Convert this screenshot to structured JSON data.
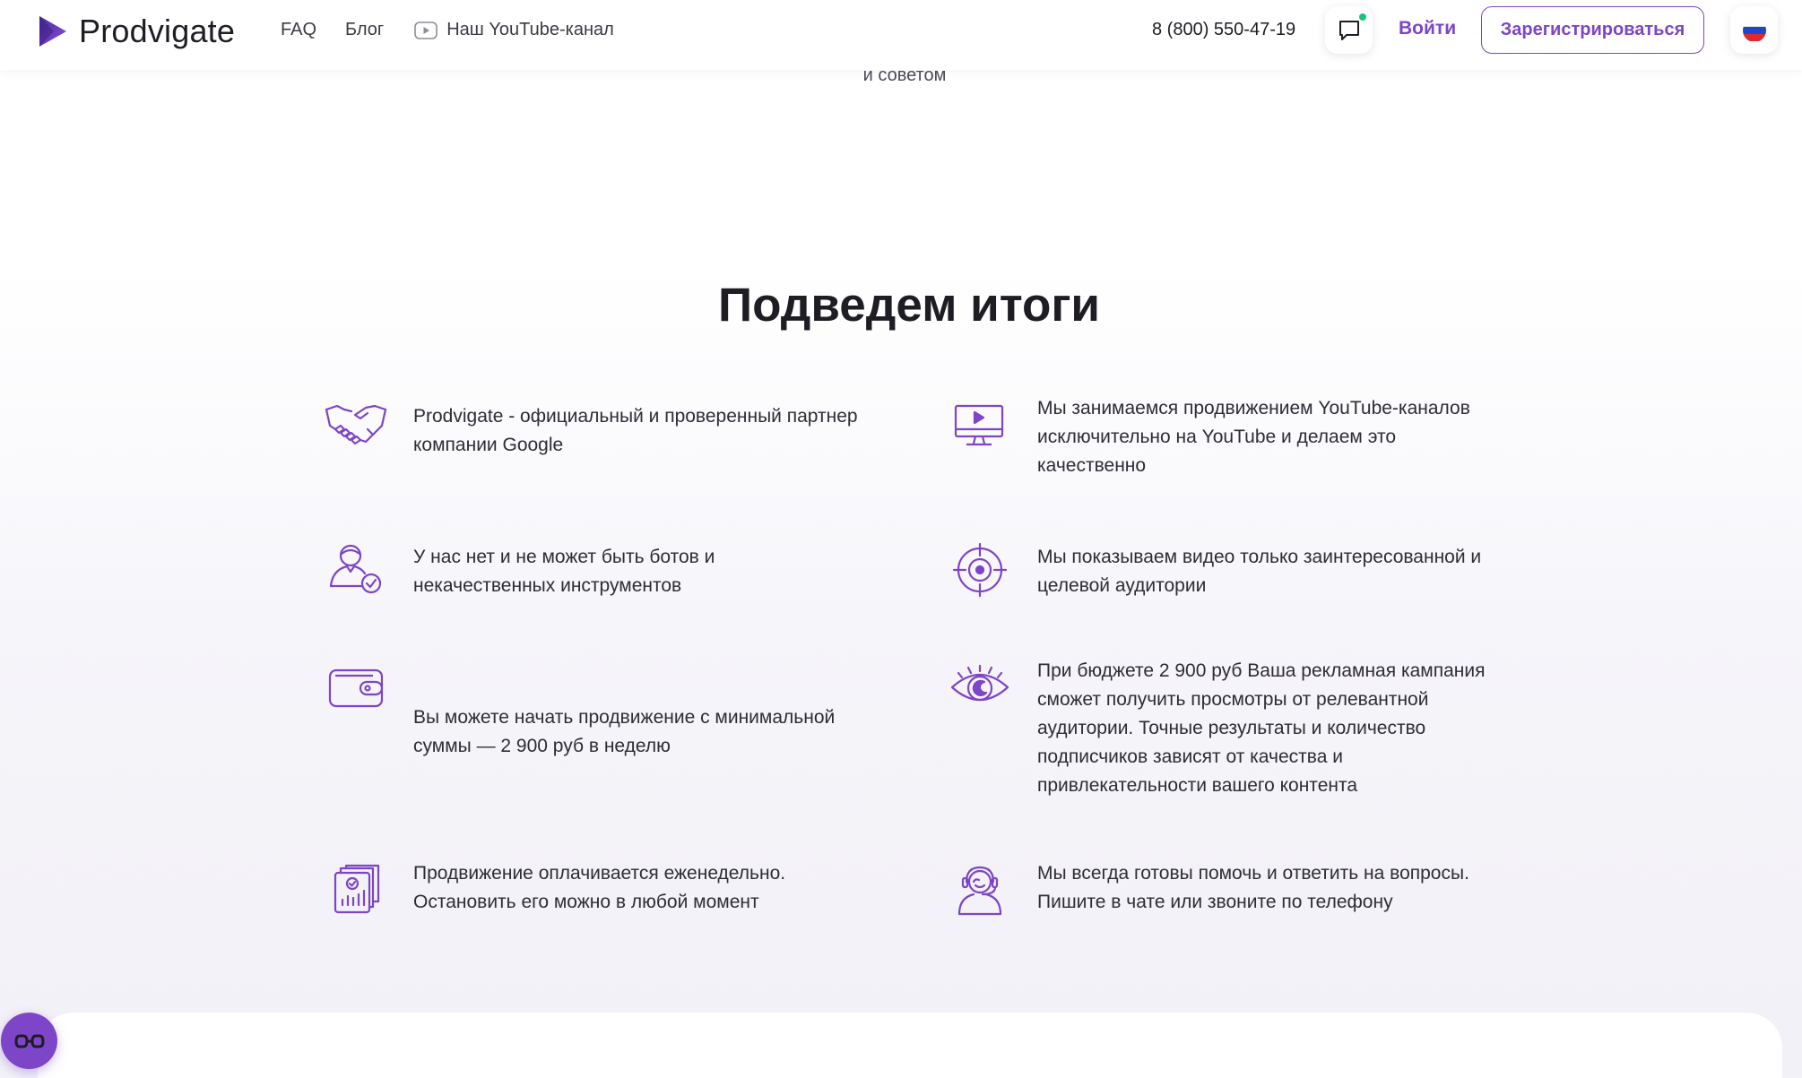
{
  "header": {
    "brand": "Prodvigate",
    "nav": {
      "faq": "FAQ",
      "blog": "Блог",
      "youtube": "Наш YouTube-канал"
    },
    "phone": "8 (800) 550-47-19",
    "login": "Войти",
    "register": "Зарегистрироваться"
  },
  "prev_section_tail": "и советом",
  "summary": {
    "title": "Подведем итоги",
    "items": [
      {
        "icon": "handshake-icon",
        "text": "Prodvigate - официальный и проверенный партнер компании Google"
      },
      {
        "icon": "monitor-play-icon",
        "text": "Мы занимаемся продвижением YouTube-каналов исключительно на YouTube и делаем это качественно"
      },
      {
        "icon": "verified-user-icon",
        "text": "У нас нет и не может быть ботов и некачественных инструментов"
      },
      {
        "icon": "target-icon",
        "text": "Мы показываем видео только заинтересованной и целевой аудитории"
      },
      {
        "icon": "wallet-icon",
        "text": "Вы можете начать продвижение с минимальной суммы — 2 900 руб в неделю"
      },
      {
        "icon": "eye-icon",
        "text": "При бюджете 2 900 руб Ваша рекламная кампания сможет получить просмотры от релевантной аудитории. Точные результаты и количество подписчиков зависят от качества и привлекательности вашего контента"
      },
      {
        "icon": "report-chart-icon",
        "text": "Продвижение оплачивается еженедельно. Остановить его можно в любой момент"
      },
      {
        "icon": "support-agent-icon",
        "text": "Мы всегда готовы помочь и ответить на вопросы. Пишите в чате или звоните по телефону"
      }
    ]
  },
  "colors": {
    "accent": "#7d45c7",
    "text": "#2e2c35",
    "online_dot": "#1bc47d"
  }
}
